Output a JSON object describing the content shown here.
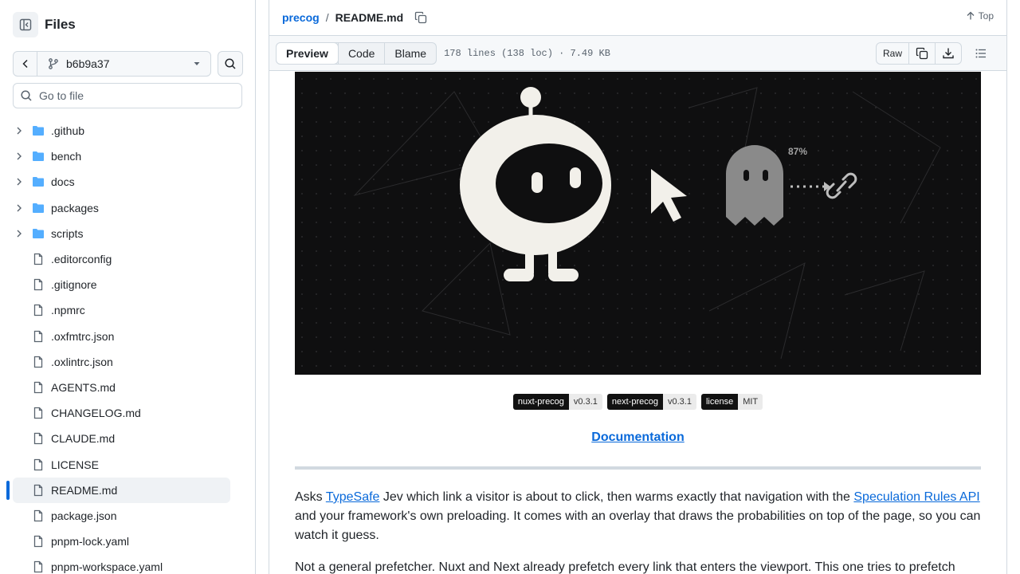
{
  "sidebar": {
    "title": "Files",
    "branch": "b6b9a37",
    "goto_placeholder": "Go to file",
    "items": [
      {
        "name": ".github",
        "type": "dir"
      },
      {
        "name": "bench",
        "type": "dir"
      },
      {
        "name": "docs",
        "type": "dir"
      },
      {
        "name": "packages",
        "type": "dir"
      },
      {
        "name": "scripts",
        "type": "dir"
      },
      {
        "name": ".editorconfig",
        "type": "file"
      },
      {
        "name": ".gitignore",
        "type": "file"
      },
      {
        "name": ".npmrc",
        "type": "file"
      },
      {
        "name": ".oxfmtrc.json",
        "type": "file"
      },
      {
        "name": ".oxlintrc.json",
        "type": "file"
      },
      {
        "name": "AGENTS.md",
        "type": "file"
      },
      {
        "name": "CHANGELOG.md",
        "type": "file"
      },
      {
        "name": "CLAUDE.md",
        "type": "file"
      },
      {
        "name": "LICENSE",
        "type": "file"
      },
      {
        "name": "README.md",
        "type": "file",
        "active": true
      },
      {
        "name": "package.json",
        "type": "file"
      },
      {
        "name": "pnpm-lock.yaml",
        "type": "file"
      },
      {
        "name": "pnpm-workspace.yaml",
        "type": "file"
      }
    ]
  },
  "header": {
    "repo": "precog",
    "separator": "/",
    "file": "README.md",
    "top_label": "Top"
  },
  "toolbar": {
    "tabs": [
      "Preview",
      "Code",
      "Blame"
    ],
    "selected_tab": "Preview",
    "meta": "178 lines (138 loc) · 7.49 KB",
    "raw_label": "Raw"
  },
  "readme": {
    "hero": {
      "percent_label": "87%"
    },
    "badges": [
      {
        "label": "nuxt-precog",
        "value": "v0.3.1"
      },
      {
        "label": "next-precog",
        "value": "v0.3.1"
      },
      {
        "label": "license",
        "value": "MIT"
      }
    ],
    "doc_link": "Documentation",
    "p1": {
      "t1": "Asks ",
      "link1": "TypeSafe",
      "t2": " Jev which link a visitor is about to click, then warms exactly that navigation with the ",
      "link2": "Speculation Rules API",
      "t3": " and your framework's own preloading. It comes with an overlay that draws the probabilities on top of the page, so you can watch it guess."
    },
    "p2": "Not a general prefetcher. Nuxt and Next already prefetch every link that enters the viewport. This one tries to prefetch"
  },
  "colors": {
    "accent": "#0969da",
    "border": "#d1d9e0",
    "hero_bg": "#0f0f10"
  }
}
